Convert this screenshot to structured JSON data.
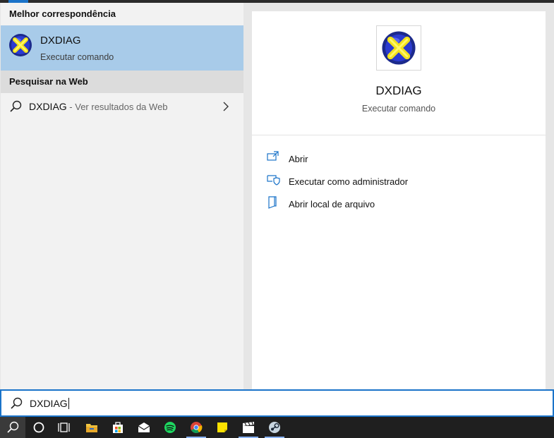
{
  "left_panel": {
    "best_match_header": "Melhor correspondência",
    "best_match": {
      "title": "DXDIAG",
      "subtitle": "Executar comando",
      "icon": "directx-icon"
    },
    "web_header": "Pesquisar na Web",
    "web_result": {
      "query": "DXDIAG",
      "suffix": " - Ver resultados da Web"
    }
  },
  "preview": {
    "title": "DXDIAG",
    "subtitle": "Executar comando",
    "actions": [
      {
        "label": "Abrir",
        "icon": "open-icon"
      },
      {
        "label": "Executar como administrador",
        "icon": "run-as-admin-icon"
      },
      {
        "label": "Abrir local de arquivo",
        "icon": "file-location-icon"
      }
    ]
  },
  "search": {
    "value": "DXDIAG"
  },
  "taskbar": {
    "items": [
      "search-icon",
      "cortana-icon",
      "task-view-icon",
      "file-explorer-icon",
      "store-icon",
      "mail-icon",
      "spotify-icon",
      "chrome-icon",
      "sticky-notes-icon",
      "video-editor-icon",
      "steam-icon"
    ]
  },
  "colors": {
    "accent": "#1a73c9",
    "selected": "#a8cbe9"
  }
}
